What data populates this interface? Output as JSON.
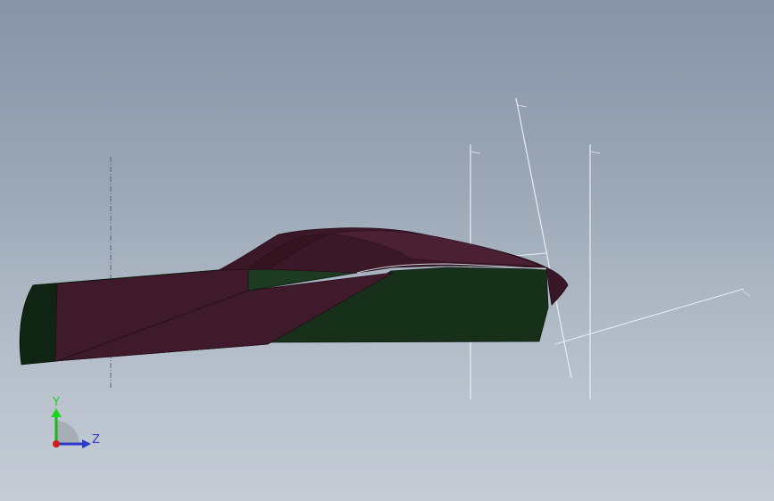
{
  "viewport": {
    "background_top": "#8794a6",
    "background_bottom": "#c5ccd6",
    "model": "car-body-surface",
    "colors": {
      "body_maroon": "#3e1a2a",
      "body_maroon_dark": "#2c1220",
      "body_green": "#17301a",
      "body_green_dark": "#0f2412",
      "reference_line": "#e6ebf0"
    }
  },
  "triad": {
    "y_label": "Y",
    "z_label": "Z",
    "y_color": "#1bd51b",
    "z_color": "#2b3cc9",
    "origin_color": "#d11a1a"
  }
}
